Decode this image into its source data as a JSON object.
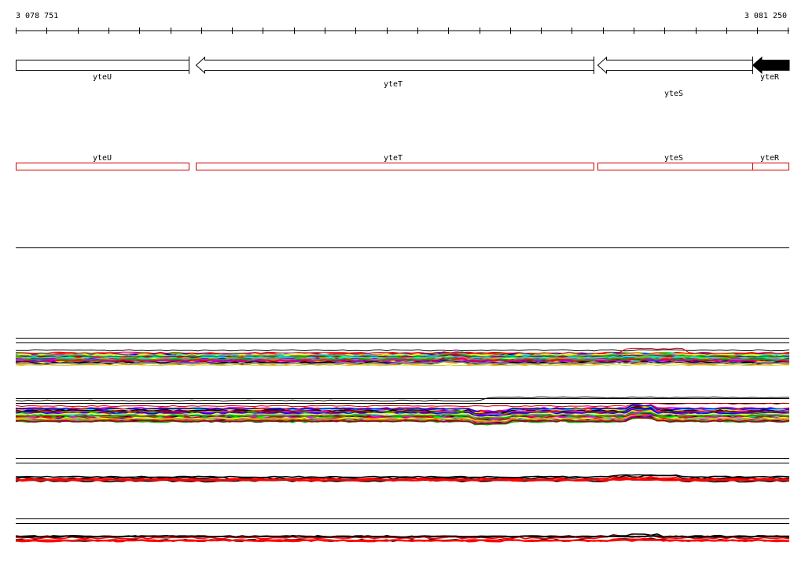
{
  "coords": {
    "start": "3 078 751",
    "end": "3 081 250"
  },
  "genes": [
    {
      "name": "yteU",
      "strand": "+",
      "highlight": false
    },
    {
      "name": "yteT",
      "strand": "-",
      "highlight": false
    },
    {
      "name": "yteS",
      "strand": "-",
      "highlight": false
    },
    {
      "name": "yteR",
      "strand": "-",
      "highlight": true
    }
  ],
  "features": [
    {
      "name": "yteU"
    },
    {
      "name": "yteT"
    },
    {
      "name": "yteS"
    },
    {
      "name": "yteR"
    }
  ],
  "colors": {
    "axis": "#000000",
    "gene_outline": "#000000",
    "gene_highlight": "#000000",
    "feature_outline": "#cc0000",
    "separator": "#000000",
    "track_palette": [
      "#ff00ff",
      "#00ff00",
      "#ff0000",
      "#0000ff",
      "#00ffff",
      "#ffff00",
      "#ff8800",
      "#8800ff",
      "#000000",
      "#888888",
      "#00aa00",
      "#aa0000"
    ],
    "track3_main": "#ff0000",
    "track3_secondary": "#000000"
  }
}
